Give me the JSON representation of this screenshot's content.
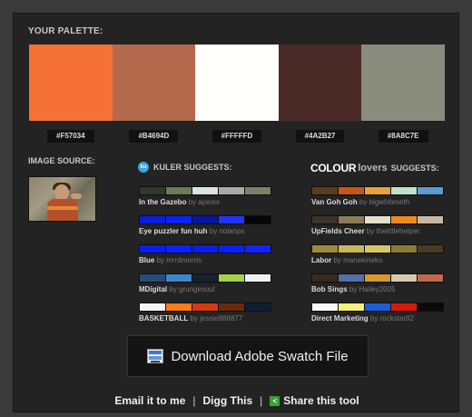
{
  "palette": {
    "heading": "YOUR PALETTE:",
    "colors": [
      {
        "hex": "#F57034",
        "label": "#F57034"
      },
      {
        "hex": "#B4694D",
        "label": "#B4694D"
      },
      {
        "hex": "#FFFFFD",
        "label": "#FFFFFD"
      },
      {
        "hex": "#4A2B27",
        "label": "#4A2B27"
      },
      {
        "hex": "#8A8C7E",
        "label": "#8A8C7E"
      }
    ]
  },
  "image_source": {
    "heading": "IMAGE SOURCE:"
  },
  "kuler": {
    "heading": "KULER SUGGESTS:",
    "icon": "kuler-icon",
    "icon_text": "ku",
    "suggestions": [
      {
        "title": "In the Gazebo",
        "by": "by",
        "author": "ajones",
        "colors": [
          "#2f3a2c",
          "#6b7a5a",
          "#d9e4e6",
          "#a9aaa8",
          "#7d8068"
        ]
      },
      {
        "title": "Eye puzzler fun huh",
        "by": "by",
        "author": "nolanps",
        "colors": [
          "#0a1de0",
          "#0b22ff",
          "#0616a0",
          "#2233ff",
          "#050505"
        ]
      },
      {
        "title": "Blue",
        "by": "by",
        "author": "mrrdmorris",
        "colors": [
          "#0b1cf0",
          "#0a22ff",
          "#0c1ee6",
          "#0a20ff",
          "#1024ff"
        ]
      },
      {
        "title": "MDigital",
        "by": "by",
        "author": "grungesoul",
        "colors": [
          "#2b4a7a",
          "#3f86c8",
          "#162030",
          "#a4d147",
          "#f1f1f1"
        ]
      },
      {
        "title": "BASKETBALL",
        "by": "by",
        "author": "jessie888877",
        "colors": [
          "#f4f4f4",
          "#ff7a1a",
          "#d63a14",
          "#6b2a0e",
          "#0f1f33"
        ]
      }
    ]
  },
  "colourlovers": {
    "logo": "COLOUR",
    "logo_suffix": "lovers",
    "heading": "SUGGESTS:",
    "suggestions": [
      {
        "title": "Van Goh Goh",
        "by": "by",
        "author": "bigwhiteseth",
        "colors": [
          "#5a3e1c",
          "#c4581a",
          "#e7a33a",
          "#bde1c8",
          "#5c9bd1"
        ]
      },
      {
        "title": "UpFields Cheer",
        "by": "by",
        "author": "thelittlehelper",
        "colors": [
          "#3d3228",
          "#8c7a5a",
          "#e6e0cc",
          "#f08a1e",
          "#c9b8a8"
        ]
      },
      {
        "title": "Labor",
        "by": "by",
        "author": "manekineko",
        "colors": [
          "#9e8a3a",
          "#c9b45a",
          "#d8c56a",
          "#8a7a3a",
          "#4a3a22"
        ]
      },
      {
        "title": "Bob Sings",
        "by": "by",
        "author": "Hailey2005",
        "colors": [
          "#3a2a1c",
          "#5470a8",
          "#d69a2a",
          "#d8c8b0",
          "#c06a4a"
        ]
      },
      {
        "title": "Direct Marketing",
        "by": "by",
        "author": "rockstar82",
        "colors": [
          "#f8f8f8",
          "#f9f27a",
          "#1a5fd8",
          "#d81a0a",
          "#0a0a0a"
        ]
      }
    ]
  },
  "download": {
    "label": "Download Adobe Swatch File",
    "icon": "swatch-file-icon"
  },
  "footer": {
    "email": "Email it to me",
    "sep1": "|",
    "digg": "Digg This",
    "sep2": "|",
    "share": "Share this tool",
    "share_icon": "share-icon",
    "share_icon_text": "<"
  }
}
